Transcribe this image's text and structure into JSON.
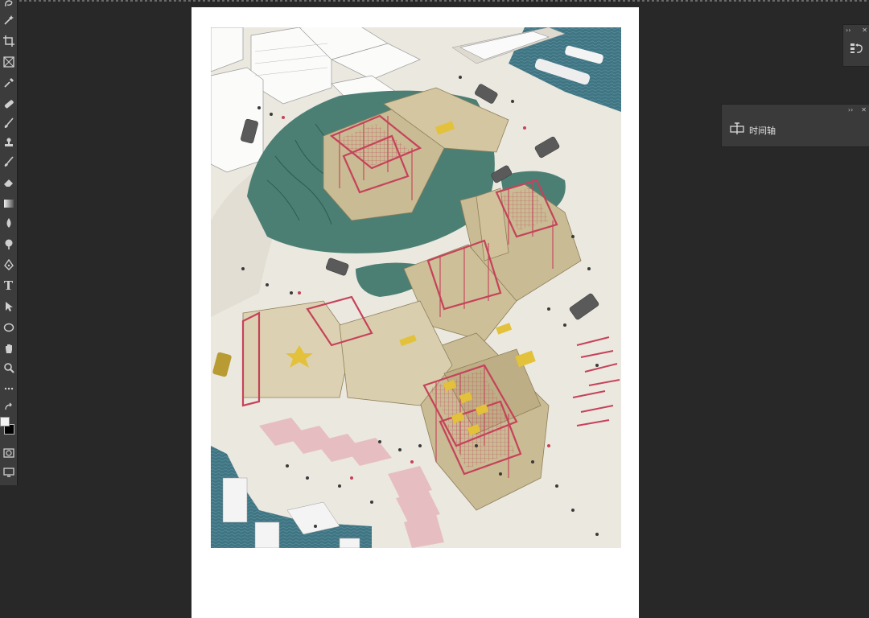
{
  "app": {
    "background": "#282828",
    "panel_bg": "#3a3a3a"
  },
  "toolbar": {
    "tools": [
      "lasso-icon",
      "magic-wand-icon",
      "crop-icon",
      "frame-icon",
      "eyedropper-icon",
      "healing-brush-icon",
      "brush-icon",
      "clone-stamp-icon",
      "history-brush-icon",
      "eraser-icon",
      "gradient-icon",
      "blur-icon",
      "dodge-icon",
      "pen-icon",
      "type-icon",
      "path-select-icon",
      "ellipse-icon",
      "hand-icon",
      "zoom-icon",
      "more-tools-icon",
      "swap-colors-icon",
      "quick-mask-icon",
      "screen-mode-icon"
    ],
    "type_tool_glyph": "T",
    "foreground_color": "#f2f2f2",
    "background_color": "#000000"
  },
  "panels": {
    "mini": {
      "collapse_glyph": "››",
      "close_glyph": "✕",
      "icon": "history-icon"
    },
    "timeline": {
      "collapse_glyph": "››",
      "close_glyph": "✕",
      "icon": "timeline-icon",
      "label": "时间轴"
    }
  },
  "document": {
    "artwork_colors": {
      "water": "#3f7583",
      "hill": "#4c7f74",
      "ground": "#ebe8df",
      "building": "#c9bb93",
      "frame": "#c6425a",
      "accent": "#e3c13a"
    }
  }
}
